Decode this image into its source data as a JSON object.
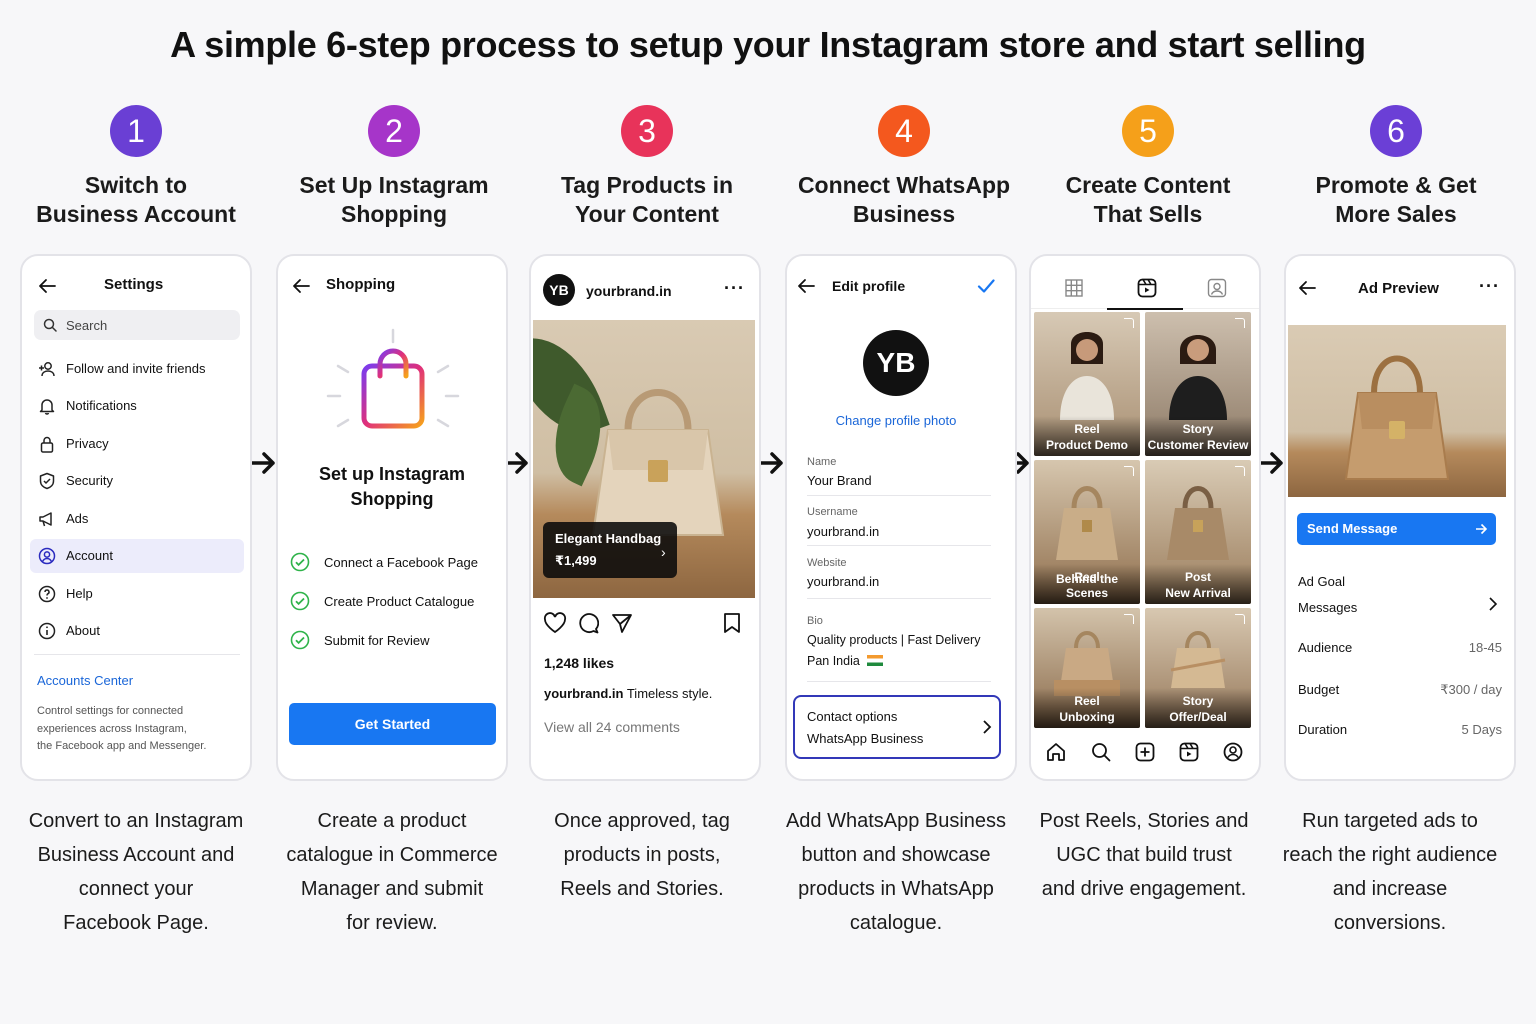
{
  "title": "A simple 6-step process to setup your Instagram store and start selling",
  "colors": {
    "step1": "#6a3fd4",
    "step2": "#a635c9",
    "step3": "#e8335a",
    "step4": "#f4581e",
    "step5": "#f5a01a",
    "step6": "#6b3fd6",
    "accent_blue": "#1877f2"
  },
  "steps": [
    {
      "number": "1",
      "title": "Switch to\nBusiness Account",
      "desc": "Convert to an Instagram\nBusiness Account and\nconnect your\nFacebook Page."
    },
    {
      "number": "2",
      "title": "Set Up Instagram\nShopping",
      "desc": "Create a product\ncatalogue in Commerce\nManager and submit\nfor review."
    },
    {
      "number": "3",
      "title": "Tag Products in\nYour Content",
      "desc": "Once approved, tag\nproducts in posts,\nReels and Stories."
    },
    {
      "number": "4",
      "title": "Connect WhatsApp\nBusiness",
      "desc": "Add WhatsApp Business\nbutton and showcase\nproducts in WhatsApp\ncatalogue."
    },
    {
      "number": "5",
      "title": "Create Content\nThat Sells",
      "desc": "Post Reels, Stories and\nUGC that build trust\nand drive engagement."
    },
    {
      "number": "6",
      "title": "Promote & Get\nMore Sales",
      "desc": "Run targeted ads to\nreach the right audience\nand increase\nconversions."
    }
  ],
  "settings": {
    "title": "Settings",
    "search_placeholder": "Search",
    "items": [
      "Follow and invite friends",
      "Notifications",
      "Privacy",
      "Security",
      "Ads",
      "Account",
      "Help",
      "About"
    ],
    "accounts_center": "Accounts Center",
    "accounts_center_desc": "Control settings for connected\nexperiences across Instagram,\nthe Facebook app and Messenger."
  },
  "shopping": {
    "title": "Shopping",
    "heading": "Set up Instagram\nShopping",
    "checklist": [
      "Connect a Facebook Page",
      "Create Product Catalogue",
      "Submit for Review"
    ],
    "button": "Get Started"
  },
  "post": {
    "avatar": "YB",
    "username": "yourbrand.in",
    "product_name": "Elegant Handbag",
    "product_price": "₹1,499",
    "likes": "1,248 likes",
    "caption_user": "yourbrand.in",
    "caption_text": "Timeless style.",
    "comments": "View all 24 comments"
  },
  "profile": {
    "title": "Edit profile",
    "avatar": "YB",
    "change_photo": "Change profile photo",
    "fields": [
      {
        "label": "Name",
        "value": "Your Brand"
      },
      {
        "label": "Username",
        "value": "yourbrand.in"
      },
      {
        "label": "Website",
        "value": "yourbrand.in"
      }
    ],
    "bio_label": "Bio",
    "bio_line1": "Quality products | Fast Delivery",
    "bio_line2": "Pan India",
    "contact_title": "Contact options",
    "contact_value": "WhatsApp Business"
  },
  "grid": {
    "tiles": [
      {
        "type": "Reel",
        "label": "Product Demo"
      },
      {
        "type": "Story",
        "label": "Customer Review"
      },
      {
        "type": "Reel",
        "label": "Behind the Scenes"
      },
      {
        "type": "Post",
        "label": "New Arrival"
      },
      {
        "type": "Reel",
        "label": "Unboxing"
      },
      {
        "type": "Story",
        "label": "Offer/Deal"
      }
    ]
  },
  "ad": {
    "title": "Ad Preview",
    "button": "Send Message",
    "goal_label": "Ad Goal",
    "goal_value": "Messages",
    "rows": [
      {
        "label": "Audience",
        "value": "18-45"
      },
      {
        "label": "Budget",
        "value": "₹300 / day"
      },
      {
        "label": "Duration",
        "value": "5 Days"
      }
    ]
  }
}
